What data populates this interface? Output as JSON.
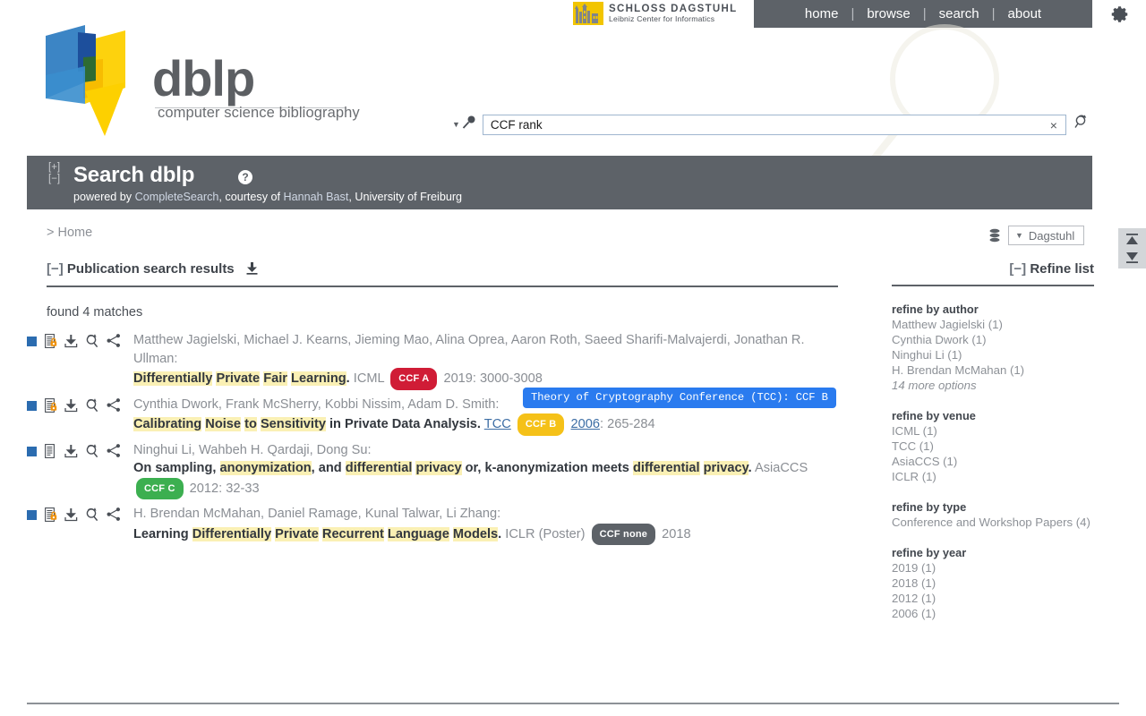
{
  "topbar": {
    "dagstuhl": {
      "title": "SCHLOSS DAGSTUHL",
      "subtitle": "Leibniz Center for Informatics"
    },
    "nav": [
      {
        "label": "home"
      },
      {
        "label": "browse"
      },
      {
        "label": "search"
      },
      {
        "label": "about"
      }
    ],
    "separator": "|",
    "gear_icon": "gear-icon",
    "navbar_color": "#5d6268"
  },
  "logo": {
    "wordmark": "dblp",
    "tagline": "computer science bibliography",
    "colors": {
      "blue": "#2b7bc0",
      "dark_blue": "#1d4f9c",
      "yellow": "#fdd000",
      "green": "#2e6b33"
    }
  },
  "search": {
    "value": "CCF rank",
    "placeholder": "",
    "clear_label": "×",
    "caret": "▼",
    "magnifier_icon": "magnifier-icon",
    "search_again_icon": "search-again-icon"
  },
  "headline": {
    "expand": "[+]",
    "collapse": "[−]",
    "title": "Search dblp",
    "help": "?",
    "subtitle_pre": "powered by ",
    "subtitle_link1": "CompleteSearch",
    "subtitle_mid": ", courtesy of ",
    "subtitle_link2": "Hannah Bast",
    "subtitle_post": ", University of Freiburg"
  },
  "breadcrumb": {
    "prefix": ">",
    "home": "Home"
  },
  "dbselect": {
    "database_icon": "database-icon",
    "caret": "▼",
    "value": "Dagstuhl"
  },
  "scrollbuttons": {
    "top_icon": "scroll-to-top-icon",
    "bottom_icon": "scroll-to-bottom-icon"
  },
  "results_header": {
    "collapse": "[−]",
    "title": "Publication search results",
    "export_icon": "export-download-icon"
  },
  "found": "found 4 matches",
  "tooltip": {
    "text": "Theory of Cryptography Conference (TCC): CCF B",
    "background": "#2a7bef"
  },
  "ccf_colors": {
    "A": "#d01c36",
    "B": "#f5c118",
    "C": "#3caf50",
    "none": "#5d6268"
  },
  "results": [
    {
      "open_access": true,
      "authors": "Matthew Jagielski, Michael J. Kearns, Jieming Mao, Alina Oprea, Aaron Roth, Saeed Sharifi-Malvajerdi, Jonathan R. Ullman:",
      "title_parts": [
        {
          "t": "Differentially",
          "hl": true
        },
        {
          "t": " ",
          "hl": false
        },
        {
          "t": "Private",
          "hl": true
        },
        {
          "t": " ",
          "hl": false
        },
        {
          "t": "Fair",
          "hl": true
        },
        {
          "t": " ",
          "hl": false
        },
        {
          "t": "Learning",
          "hl": true
        },
        {
          "t": ".",
          "hl": false
        }
      ],
      "venue": "ICML",
      "venue_link": false,
      "ccf": "CCF A",
      "ccf_level": "A",
      "year": "2019",
      "year_link": false,
      "pages": ": 3000-3008"
    },
    {
      "open_access": true,
      "authors": "Cynthia Dwork, Frank McSherry, Kobbi Nissim, Adam D. Smith:",
      "title_parts": [
        {
          "t": "Calibrating",
          "hl": true
        },
        {
          "t": " ",
          "hl": false
        },
        {
          "t": "Noise",
          "hl": true
        },
        {
          "t": " ",
          "hl": false
        },
        {
          "t": "to",
          "hl": true
        },
        {
          "t": " ",
          "hl": false
        },
        {
          "t": "Sensitivity",
          "hl": true
        },
        {
          "t": " in Private Data Analysis.",
          "hl": false
        }
      ],
      "venue": "TCC",
      "venue_link": true,
      "ccf": "CCF B",
      "ccf_level": "B",
      "year": "2006",
      "year_link": true,
      "pages": ": 265-284"
    },
    {
      "open_access": false,
      "authors": "Ninghui Li, Wahbeh H. Qardaji, Dong Su:",
      "title_parts": [
        {
          "t": "On sampling, ",
          "hl": false
        },
        {
          "t": "anonymization",
          "hl": true
        },
        {
          "t": ", and ",
          "hl": false
        },
        {
          "t": "differential",
          "hl": true
        },
        {
          "t": " ",
          "hl": false
        },
        {
          "t": "privacy",
          "hl": true
        },
        {
          "t": " or, k-anonymization meets ",
          "hl": false
        },
        {
          "t": "differential",
          "hl": true
        },
        {
          "t": " ",
          "hl": false
        },
        {
          "t": "privacy",
          "hl": true
        },
        {
          "t": ".",
          "hl": false
        }
      ],
      "venue": "AsiaCCS",
      "venue_link": false,
      "ccf": "CCF C",
      "ccf_level": "C",
      "year": "2012",
      "year_link": false,
      "pages": ": 32-33"
    },
    {
      "open_access": true,
      "authors": "H. Brendan McMahan, Daniel Ramage, Kunal Talwar, Li Zhang:",
      "title_parts": [
        {
          "t": "Learning ",
          "hl": false
        },
        {
          "t": "Differentially",
          "hl": true
        },
        {
          "t": " ",
          "hl": false
        },
        {
          "t": "Private",
          "hl": true
        },
        {
          "t": " ",
          "hl": false
        },
        {
          "t": "Recurrent",
          "hl": true
        },
        {
          "t": " ",
          "hl": false
        },
        {
          "t": "Language",
          "hl": true
        },
        {
          "t": " ",
          "hl": false
        },
        {
          "t": "Models",
          "hl": true
        },
        {
          "t": ".",
          "hl": false
        }
      ],
      "venue": "ICLR (Poster)",
      "venue_link": false,
      "ccf": "CCF none",
      "ccf_level": "none",
      "year": "2018",
      "year_link": false,
      "pages": ""
    }
  ],
  "refine": {
    "collapse": "[−]",
    "title": "Refine list",
    "groups": [
      {
        "title": "refine by author",
        "items": [
          "Matthew Jagielski (1)",
          "Cynthia Dwork (1)",
          "Ninghui Li (1)",
          "H. Brendan McMahan (1)"
        ],
        "more": "14 more options"
      },
      {
        "title": "refine by venue",
        "items": [
          "ICML (1)",
          "TCC (1)",
          "AsiaCCS (1)",
          "ICLR (1)"
        ],
        "more": ""
      },
      {
        "title": "refine by type",
        "items": [
          "Conference and Workshop Papers (4)"
        ],
        "more": ""
      },
      {
        "title": "refine by year",
        "items": [
          "2019 (1)",
          "2018 (1)",
          "2012 (1)",
          "2006 (1)"
        ],
        "more": ""
      }
    ]
  }
}
